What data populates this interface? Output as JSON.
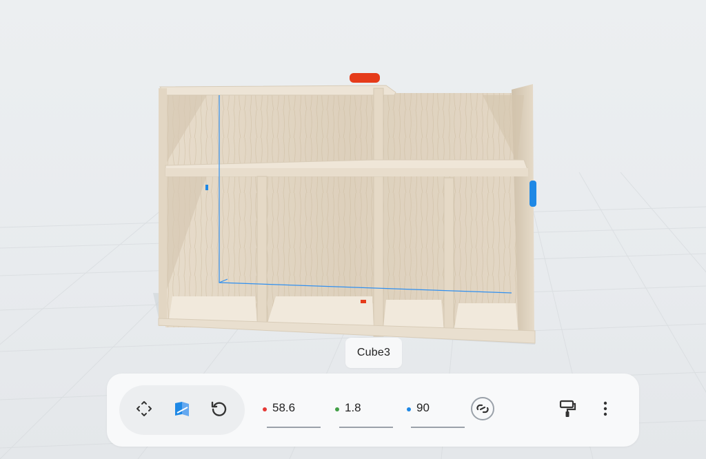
{
  "object": {
    "name": "Cube3"
  },
  "toolbar": {
    "modes": [
      {
        "id": "move",
        "icon": "move-arrows-icon"
      },
      {
        "id": "scale",
        "icon": "resize-cube-icon",
        "active": true
      },
      {
        "id": "rotate",
        "icon": "rotate-icon"
      }
    ],
    "coords": [
      {
        "axis": "x",
        "value": "58.6",
        "color": "#e53935"
      },
      {
        "axis": "y",
        "value": "1.8",
        "color": "#43a047"
      },
      {
        "axis": "z",
        "value": "90",
        "color": "#1e88e5"
      }
    ],
    "link_icon": "link-icon",
    "paint_icon": "paint-roller-icon",
    "more_icon": "more-vertical-icon"
  },
  "colors": {
    "accent": "#1e88e5",
    "handle_red": "#e53b1a",
    "toolbar_bg": "#f8f9fa",
    "wood": "#e8dccb"
  }
}
